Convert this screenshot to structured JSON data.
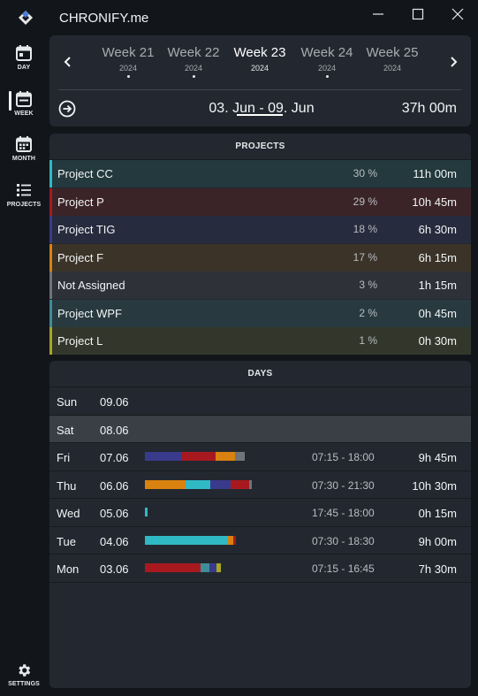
{
  "app": {
    "title": "CHRONIFY.me"
  },
  "sidebar": {
    "items": [
      {
        "label": "DAY",
        "icon": "calendar-day-icon"
      },
      {
        "label": "WEEK",
        "icon": "calendar-week-icon",
        "active": true
      },
      {
        "label": "MONTH",
        "icon": "calendar-month-icon"
      },
      {
        "label": "PROJECTS",
        "icon": "list-icon"
      }
    ],
    "settings_label": "SETTINGS"
  },
  "weeks": [
    {
      "name": "Week 21",
      "year": "2024",
      "has_entries": true
    },
    {
      "name": "Week 22",
      "year": "2024",
      "has_entries": true
    },
    {
      "name": "Week 23",
      "year": "2024",
      "has_entries": false,
      "selected": true
    },
    {
      "name": "Week 24",
      "year": "2024",
      "has_entries": true
    },
    {
      "name": "Week 25",
      "year": "2024",
      "has_entries": false
    }
  ],
  "summary": {
    "range": "03. Jun - 09. Jun",
    "total": "37h 00m"
  },
  "projects_title": "PROJECTS",
  "projects": [
    {
      "name": "Project CC",
      "percent": "30 %",
      "hours": "11h 00m",
      "color": "#2fb9c4",
      "bg": "#23393d"
    },
    {
      "name": "Project P",
      "percent": "29 %",
      "hours": "10h 45m",
      "color": "#a8191f",
      "bg": "#3b2428"
    },
    {
      "name": "Project TIG",
      "percent": "18 %",
      "hours": "6h 30m",
      "color": "#3a3a8c",
      "bg": "#262b3d"
    },
    {
      "name": "Project F",
      "percent": "17 %",
      "hours": "6h 15m",
      "color": "#d9820f",
      "bg": "#3b3328"
    },
    {
      "name": "Not Assigned",
      "percent": "3 %",
      "hours": "1h 15m",
      "color": "#707378",
      "bg": "#2e3238"
    },
    {
      "name": "Project WPF",
      "percent": "2 %",
      "hours": "0h 45m",
      "color": "#3f8d99",
      "bg": "#283a3f"
    },
    {
      "name": "Project L",
      "percent": "1 %",
      "hours": "0h 30m",
      "color": "#a8a81f",
      "bg": "#33372b"
    }
  ],
  "days_title": "DAYS",
  "days": [
    {
      "name": "Sun",
      "date": "09.06",
      "range": "",
      "total": "",
      "segments": []
    },
    {
      "name": "Sat",
      "date": "08.06",
      "range": "",
      "total": "",
      "segments": [],
      "highlight": true
    },
    {
      "name": "Fri",
      "date": "07.06",
      "range": "07:15 - 18:00",
      "total": "9h 45m",
      "segments": [
        {
          "color": "#3a3a8c",
          "weight": 42
        },
        {
          "color": "#a8191f",
          "weight": 38
        },
        {
          "color": "#d9820f",
          "weight": 22
        },
        {
          "color": "#707378",
          "weight": 11
        }
      ]
    },
    {
      "name": "Thu",
      "date": "06.06",
      "range": "07:30 - 21:30",
      "total": "10h 30m",
      "segments": [
        {
          "color": "#d9820f",
          "weight": 46
        },
        {
          "color": "#2fb9c4",
          "weight": 28
        },
        {
          "color": "#3a3a8c",
          "weight": 23
        },
        {
          "color": "#a8191f",
          "weight": 21
        },
        {
          "color": "#707378",
          "weight": 3
        }
      ]
    },
    {
      "name": "Wed",
      "date": "05.06",
      "range": "17:45 - 18:00",
      "total": "0h 15m",
      "segments": [
        {
          "color": "#2fb9c4",
          "weight": 3
        }
      ]
    },
    {
      "name": "Tue",
      "date": "04.06",
      "range": "07:30 - 18:30",
      "total": "9h 00m",
      "segments": [
        {
          "color": "#2fb9c4",
          "weight": 94
        },
        {
          "color": "#d9820f",
          "weight": 6
        },
        {
          "color": "#a8191f",
          "weight": 3
        }
      ]
    },
    {
      "name": "Mon",
      "date": "03.06",
      "range": "07:15 - 16:45",
      "total": "7h 30m",
      "segments": [
        {
          "color": "#a8191f",
          "weight": 63
        },
        {
          "color": "#3f8d99",
          "weight": 10
        },
        {
          "color": "#3a3a8c",
          "weight": 8
        },
        {
          "color": "#a8a81f",
          "weight": 5
        }
      ]
    }
  ]
}
